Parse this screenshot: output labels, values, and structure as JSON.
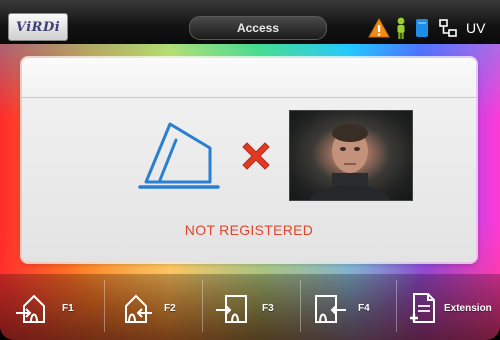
{
  "header": {
    "logo_text": "ViRDi",
    "title": "Access",
    "status_icons": [
      "warning-icon",
      "person-icon",
      "card-icon",
      "network-icon",
      "uv-icon"
    ],
    "uv_label": "UV",
    "colors": {
      "warning": "#f28a17",
      "person": "#9bd12a",
      "card": "#1d8de8"
    }
  },
  "main": {
    "status_message": "NOT REGISTERED",
    "status_color": "#e2452c",
    "result_icon": "red-x-icon",
    "scanner_icon": "fingerprint-scanner-icon"
  },
  "function_keys": [
    {
      "label": "F1",
      "icon": "home-enter-icon"
    },
    {
      "label": "F2",
      "icon": "home-leave-icon"
    },
    {
      "label": "F3",
      "icon": "door-enter-icon"
    },
    {
      "label": "F4",
      "icon": "door-leave-icon"
    },
    {
      "label": "Extension",
      "icon": "document-add-icon"
    }
  ]
}
